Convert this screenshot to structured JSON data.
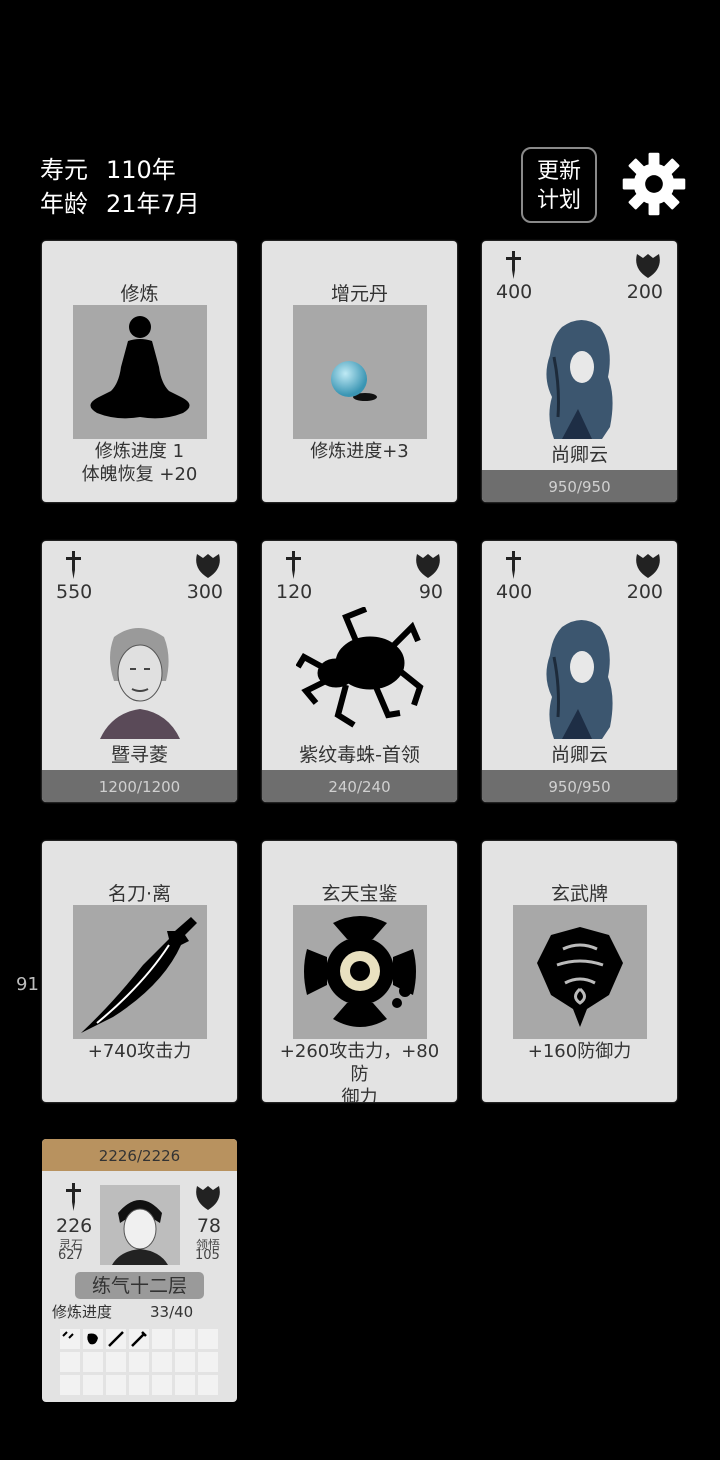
{
  "hud": {
    "lifespan_label": "寿元",
    "lifespan_value": "110年",
    "age_label": "年龄",
    "age_value": "21年7月",
    "plan_button_line1": "更新",
    "plan_button_line2": "计划",
    "settings_icon": "gear-icon"
  },
  "cards": [
    {
      "type": "action",
      "title": "修炼",
      "art": "meditation-silhouette",
      "desc1": "修炼进度  1",
      "desc2": "体魄恢复  +20"
    },
    {
      "type": "item",
      "title": "增元丹",
      "art": "pill-orb",
      "desc1": "修炼进度+3"
    },
    {
      "type": "enemy",
      "attack": "400",
      "defense": "200",
      "name": "尚卿云",
      "hp": "950/950",
      "portrait": "blue-haired-woman"
    },
    {
      "type": "enemy",
      "attack": "550",
      "defense": "300",
      "name": "暨寻菱",
      "hp": "1200/1200",
      "portrait": "grey-haired-old-woman"
    },
    {
      "type": "enemy",
      "attack": "120",
      "defense": "90",
      "name": "紫纹毒蛛-首领",
      "hp": "240/240",
      "portrait": "spider-boss"
    },
    {
      "type": "enemy",
      "attack": "400",
      "defense": "200",
      "name": "尚卿云",
      "hp": "950/950",
      "portrait": "blue-haired-woman"
    },
    {
      "type": "equipment",
      "title": "名刀·离",
      "art": "saber",
      "desc1": "+740攻击力"
    },
    {
      "type": "equipment",
      "title": "玄天宝鉴",
      "art": "mirror-treasure",
      "desc1": "+260攻击力，+80防",
      "desc2": "御力"
    },
    {
      "type": "equipment",
      "title": "玄武牌",
      "art": "xuanwu-token",
      "desc1": "+160防御力"
    }
  ],
  "side_number": "91",
  "player": {
    "hp": "2226/2226",
    "attack": "226",
    "defense": "78",
    "spirit_stone_label": "灵石",
    "spirit_stone_value": "627",
    "insight_label": "领悟",
    "insight_value": "105",
    "realm": "练气十二层",
    "progress_label": "修炼进度",
    "progress_value": "33/40",
    "inventory": [
      "feather-glyph",
      "dragon-glyph",
      "blade-glyph",
      "blade-glyph",
      "",
      "",
      "",
      "",
      "",
      "",
      "",
      "",
      "",
      "",
      "",
      "",
      "",
      "",
      "",
      "",
      ""
    ]
  },
  "colors": {
    "background": "#000000",
    "card": "#e3e3e3",
    "hp_bar": "#6e6e6e",
    "player_hp_bar": "#b8925f",
    "art_bg": "#a8a8a8"
  }
}
